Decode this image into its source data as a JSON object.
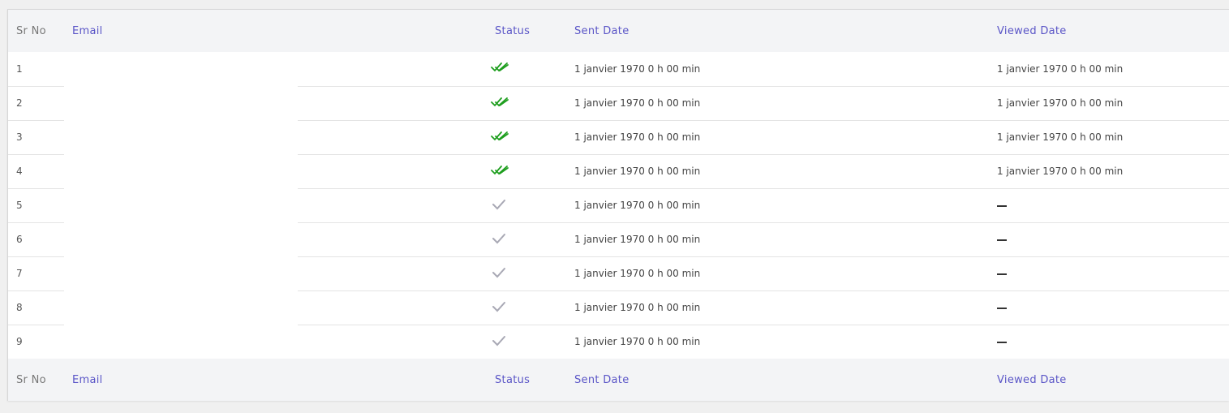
{
  "columns": {
    "sr_no": "Sr No",
    "email": "Email",
    "status": "Status",
    "sent_date": "Sent Date",
    "viewed_date": "Viewed Date"
  },
  "rows": [
    {
      "sr": "1",
      "email": "",
      "status": "read",
      "sent": "1 janvier 1970 0 h 00 min",
      "viewed": "1 janvier 1970 0 h 00 min"
    },
    {
      "sr": "2",
      "email": "",
      "status": "read",
      "sent": "1 janvier 1970 0 h 00 min",
      "viewed": "1 janvier 1970 0 h 00 min"
    },
    {
      "sr": "3",
      "email": "",
      "status": "read",
      "sent": "1 janvier 1970 0 h 00 min",
      "viewed": "1 janvier 1970 0 h 00 min"
    },
    {
      "sr": "4",
      "email": "",
      "status": "read",
      "sent": "1 janvier 1970 0 h 00 min",
      "viewed": "1 janvier 1970 0 h 00 min"
    },
    {
      "sr": "5",
      "email": "",
      "status": "sent",
      "sent": "1 janvier 1970 0 h 00 min",
      "viewed": ""
    },
    {
      "sr": "6",
      "email": "",
      "status": "sent",
      "sent": "1 janvier 1970 0 h 00 min",
      "viewed": ""
    },
    {
      "sr": "7",
      "email": "",
      "status": "sent",
      "sent": "1 janvier 1970 0 h 00 min",
      "viewed": ""
    },
    {
      "sr": "8",
      "email": "",
      "status": "sent",
      "sent": "1 janvier 1970 0 h 00 min",
      "viewed": ""
    },
    {
      "sr": "9",
      "email": "",
      "status": "sent",
      "sent": "1 janvier 1970 0 h 00 min",
      "viewed": ""
    }
  ],
  "icons": {
    "read": "double-check-icon",
    "sent": "single-check-icon",
    "empty": "dash-icon"
  },
  "colors": {
    "header_text": "#5a55c7",
    "read_check": "#1e9e1e",
    "sent_check": "#a8a8b4",
    "header_bg": "#f3f4f6"
  }
}
